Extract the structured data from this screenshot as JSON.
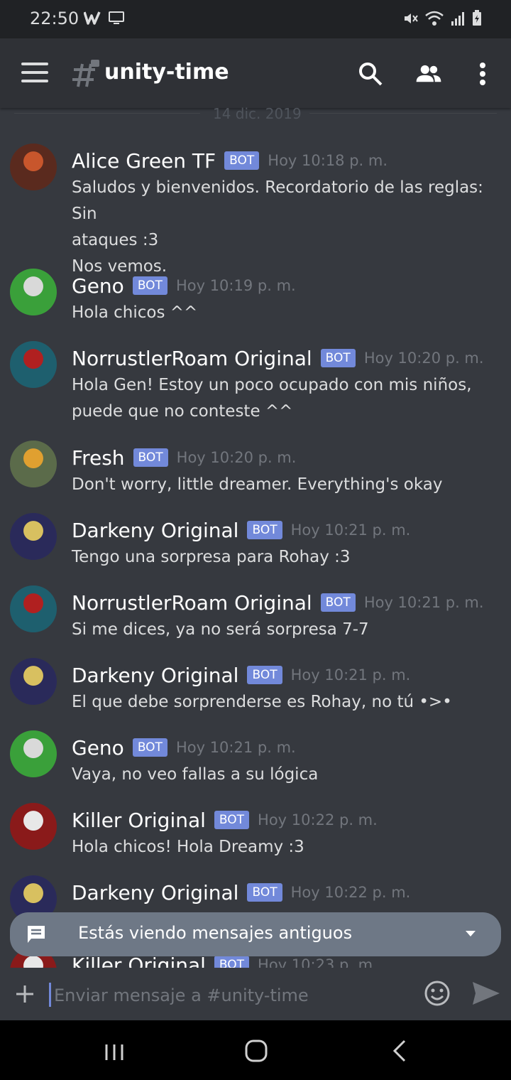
{
  "status_bar": {
    "time": "22:50"
  },
  "header": {
    "channel_name": "unity-time"
  },
  "date_divider": "14 dic. 2019",
  "messages": [
    {
      "author": "Alice Green TF",
      "tag": "BOT",
      "timestamp": "Hoy 10:18 p. m.",
      "lines": [
        "Saludos y bienvenidos. Recordatorio de las reglas: Sin",
        "ataques :3",
        "Nos vemos."
      ],
      "avatar_colors": [
        "#5a2a1e",
        "#c8562c"
      ]
    },
    {
      "author": "Geno",
      "tag": "BOT",
      "timestamp": "Hoy 10:19 p. m.",
      "lines": [
        "Hola chicos ^^"
      ],
      "avatar_colors": [
        "#3aa03a",
        "#d9d9d9"
      ]
    },
    {
      "author": "NorrustlerRoam Original",
      "tag": "BOT",
      "timestamp": "Hoy 10:20 p. m.",
      "lines": [
        "Hola Gen! Estoy un poco ocupado con mis niños,",
        "puede que no conteste ^^"
      ],
      "avatar_colors": [
        "#1e5f6e",
        "#b02020"
      ]
    },
    {
      "author": "Fresh",
      "tag": "BOT",
      "timestamp": "Hoy 10:20 p. m.",
      "lines": [
        "Don't worry, little dreamer. Everything's okay"
      ],
      "avatar_colors": [
        "#5b6b4a",
        "#e0a030"
      ]
    },
    {
      "author": "Darkeny Original",
      "tag": "BOT",
      "timestamp": "Hoy 10:21 p. m.",
      "lines": [
        "Tengo una sorpresa para Rohay :3"
      ],
      "avatar_colors": [
        "#2a2a5a",
        "#d8c060"
      ]
    },
    {
      "author": "NorrustlerRoam Original",
      "tag": "BOT",
      "timestamp": "Hoy 10:21 p. m.",
      "lines": [
        "Si me dices, ya no será sorpresa 7-7"
      ],
      "avatar_colors": [
        "#1e5f6e",
        "#b02020"
      ]
    },
    {
      "author": "Darkeny Original",
      "tag": "BOT",
      "timestamp": "Hoy 10:21 p. m.",
      "lines": [
        "El que debe sorprenderse es Rohay, no tú •>•"
      ],
      "avatar_colors": [
        "#2a2a5a",
        "#d8c060"
      ]
    },
    {
      "author": "Geno",
      "tag": "BOT",
      "timestamp": "Hoy 10:21 p. m.",
      "lines": [
        "Vaya, no veo fallas a su lógica"
      ],
      "avatar_colors": [
        "#3aa03a",
        "#d9d9d9"
      ]
    },
    {
      "author": "Killer Original",
      "tag": "BOT",
      "timestamp": "Hoy 10:22 p. m.",
      "lines": [
        "Hola chicos! Hola Dreamy :3"
      ],
      "avatar_colors": [
        "#8a1a1a",
        "#e8e8e8"
      ]
    },
    {
      "author": "Darkeny Original",
      "tag": "BOT",
      "timestamp": "Hoy 10:22 p. m.",
      "lines": [],
      "avatar_colors": [
        "#2a2a5a",
        "#d8c060"
      ]
    },
    {
      "author": "Killer Original",
      "tag": "BOT",
      "timestamp": "Hoy 10:23 p. m.",
      "lines": [],
      "avatar_colors": [
        "#8a1a1a",
        "#e8e8e8"
      ]
    }
  ],
  "old_messages_banner": {
    "text": "Estás viendo mensajes antiguos"
  },
  "composer": {
    "placeholder": "Enviar mensaje a #unity-time"
  },
  "colors": {
    "background": "#36393f",
    "header": "#2f3136",
    "bot_tag": "#7289da",
    "banner": "#6e7886"
  },
  "icons": [
    "menu-icon",
    "channel-hash-lock-icon",
    "search-icon",
    "members-icon",
    "more-vertical-icon",
    "chat-bubble-icon",
    "chevron-down-icon",
    "plus-icon",
    "emoji-icon",
    "send-icon"
  ]
}
